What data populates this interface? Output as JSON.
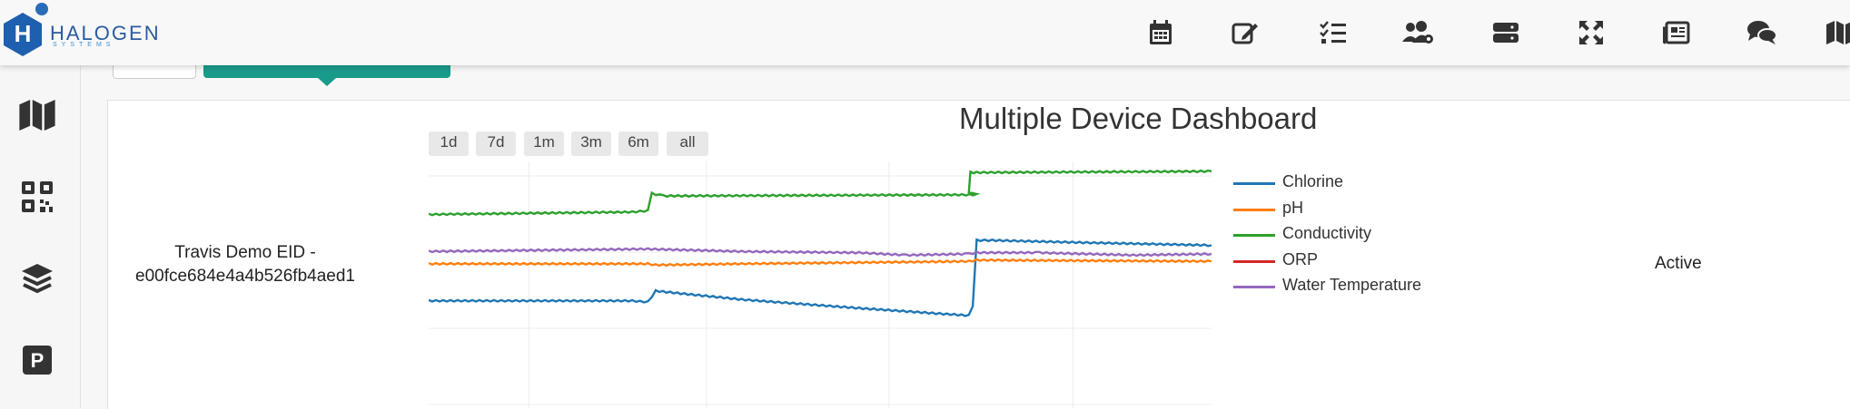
{
  "brand": {
    "logo_letter": "H",
    "name": "HALOGEN",
    "subtitle": "SYSTEMS"
  },
  "topnav": [
    "calendar-icon",
    "edit-icon",
    "checklist-icon",
    "users-gear-icon",
    "server-icon",
    "expand-icon",
    "newspaper-icon",
    "chat-icon",
    "map-icon"
  ],
  "sidebar": [
    "map-icon",
    "qrcode-icon",
    "layers-icon",
    "parking-icon"
  ],
  "device": {
    "name_line1": "Travis Demo EID -",
    "name_line2": "e00fce684e4a4b526fb4aed1",
    "status": "Active"
  },
  "chart": {
    "title": "Multiple Device Dashboard",
    "range_buttons": [
      "1d",
      "7d",
      "1m",
      "3m",
      "6m",
      "all"
    ]
  },
  "chart_data": {
    "type": "line",
    "title": "Multiple Device Dashboard",
    "legend_position": "right",
    "grid": true,
    "series": [
      {
        "name": "Chlorine",
        "color": "#1f77b4"
      },
      {
        "name": "pH",
        "color": "#ff7f0e"
      },
      {
        "name": "Conductivity",
        "color": "#2ca02c"
      },
      {
        "name": "ORP",
        "color": "#d62728"
      },
      {
        "name": "Water Temperature",
        "color": "#9467bd"
      }
    ]
  }
}
